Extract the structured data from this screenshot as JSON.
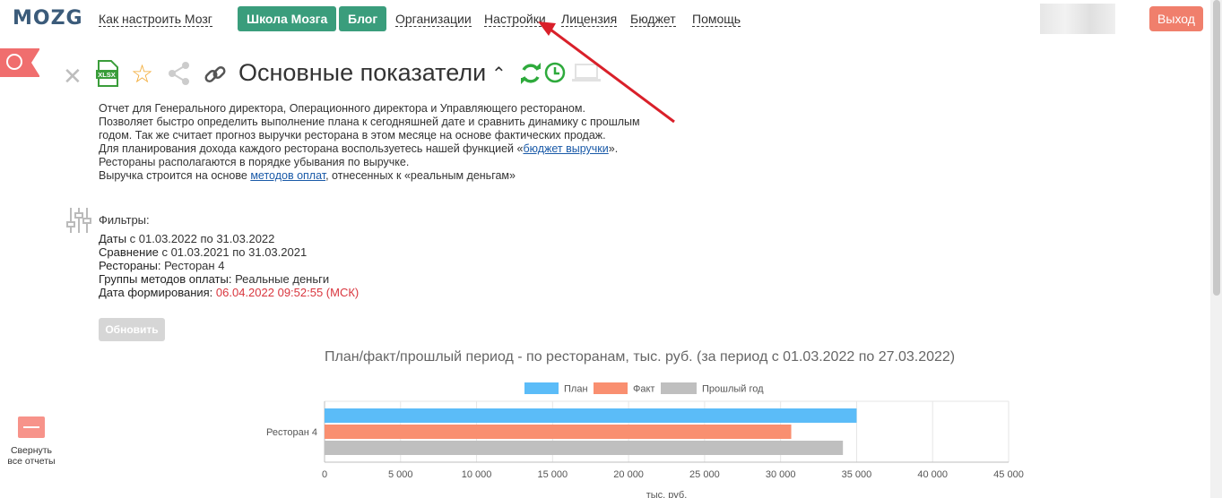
{
  "brand": {
    "logo": "MOZG",
    "accent": "#3a9d7c",
    "logout_color": "#f07f6c"
  },
  "nav": {
    "how_to": "Как настроить Мозг",
    "school": "Школа Мозга",
    "blog": "Блог",
    "organizations": "Организации",
    "settings": "Настройки",
    "license": "Лицензия",
    "budget": "Бюджет",
    "help": "Помощь",
    "logout": "Выход"
  },
  "report": {
    "title": "Основные показатели",
    "description": {
      "line1": "Отчет для Генерального директора, Операционного директора и Управляющего рестораном.",
      "line2": "Позволяет быстро определить выполнение плана к сегодняшней дате и сравнить динамику с прошлым годом. Так же считает прогноз выручки ресторана в этом месяце на основе фактических продаж.",
      "line3_pre": "Для планирования дохода каждого ресторана воспользуетесь нашей функцией «",
      "line3_link": "бюджет выручки",
      "line3_post": "».",
      "line4": "Рестораны располагаются в порядке убывания по выручке.",
      "line5_pre": "Выручка строится на основе ",
      "line5_link": "методов оплат",
      "line5_post": ", отнесенных к «реальным деньгам»"
    }
  },
  "filters": {
    "heading": "Фильтры:",
    "dates_label": "Даты",
    "dates_value": " с 01.03.2022 по 31.03.2022",
    "compare_label": "Сравнение",
    "compare_value": " с 01.03.2021 по 31.03.2021",
    "restaurants_label": "Рестораны:",
    "restaurants_value": " Ресторан 4",
    "groups_label": "Группы методов оплаты:",
    "groups_value": " Реальные деньги",
    "generated_label": "Дата формирования:",
    "generated_value": " 06.04.2022 09:52:55 (МСК)"
  },
  "update_button": "Обновить",
  "sidebar": {
    "collapse_label_1": "Свернуть",
    "collapse_label_2": "все отчеты"
  },
  "chart_data": {
    "type": "bar",
    "orientation": "horizontal",
    "title": "План/факт/прошлый период - по ресторанам, тыс. руб. (за период с 01.03.2022 по 27.03.2022)",
    "xlabel": "тыс. руб.",
    "categories": [
      "Ресторан 4"
    ],
    "series": [
      {
        "name": "План",
        "values": [
          35000
        ],
        "color": "#5bbcf8"
      },
      {
        "name": "Факт",
        "values": [
          30700
        ],
        "color": "#f98f70"
      },
      {
        "name": "Прошлый год",
        "values": [
          34100
        ],
        "color": "#bfbfbf"
      }
    ],
    "xlim": [
      0,
      45000
    ],
    "xticks": [
      "0",
      "5 000",
      "10 000",
      "15 000",
      "20 000",
      "25 000",
      "30 000",
      "35 000",
      "40 000",
      "45 000"
    ],
    "grid": true,
    "legend_position": "top"
  }
}
